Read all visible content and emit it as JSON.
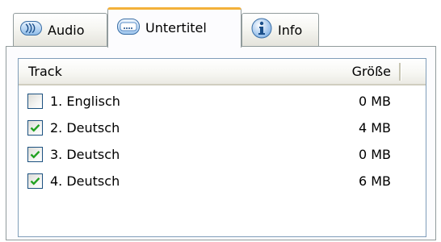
{
  "tabs": [
    {
      "label": "Audio",
      "icon": "audio-icon",
      "selected": false
    },
    {
      "label": "Untertitel",
      "icon": "subtitle-icon",
      "selected": true
    },
    {
      "label": "Info",
      "icon": "info-icon",
      "selected": false
    }
  ],
  "table": {
    "columns": [
      "Track",
      "Größe"
    ],
    "rows": [
      {
        "name": "1. Englisch",
        "size": "0 MB",
        "checked": false
      },
      {
        "name": "2. Deutsch",
        "size": "4 MB",
        "checked": true
      },
      {
        "name": "3. Deutsch",
        "size": "0 MB",
        "checked": true
      },
      {
        "name": "4. Deutsch",
        "size": "6 MB",
        "checked": true
      }
    ]
  },
  "colors": {
    "selected_tab_accent": "#f3b13a",
    "checkmark": "#21a121",
    "border": "#919b9c",
    "list_border": "#7f9db9"
  }
}
